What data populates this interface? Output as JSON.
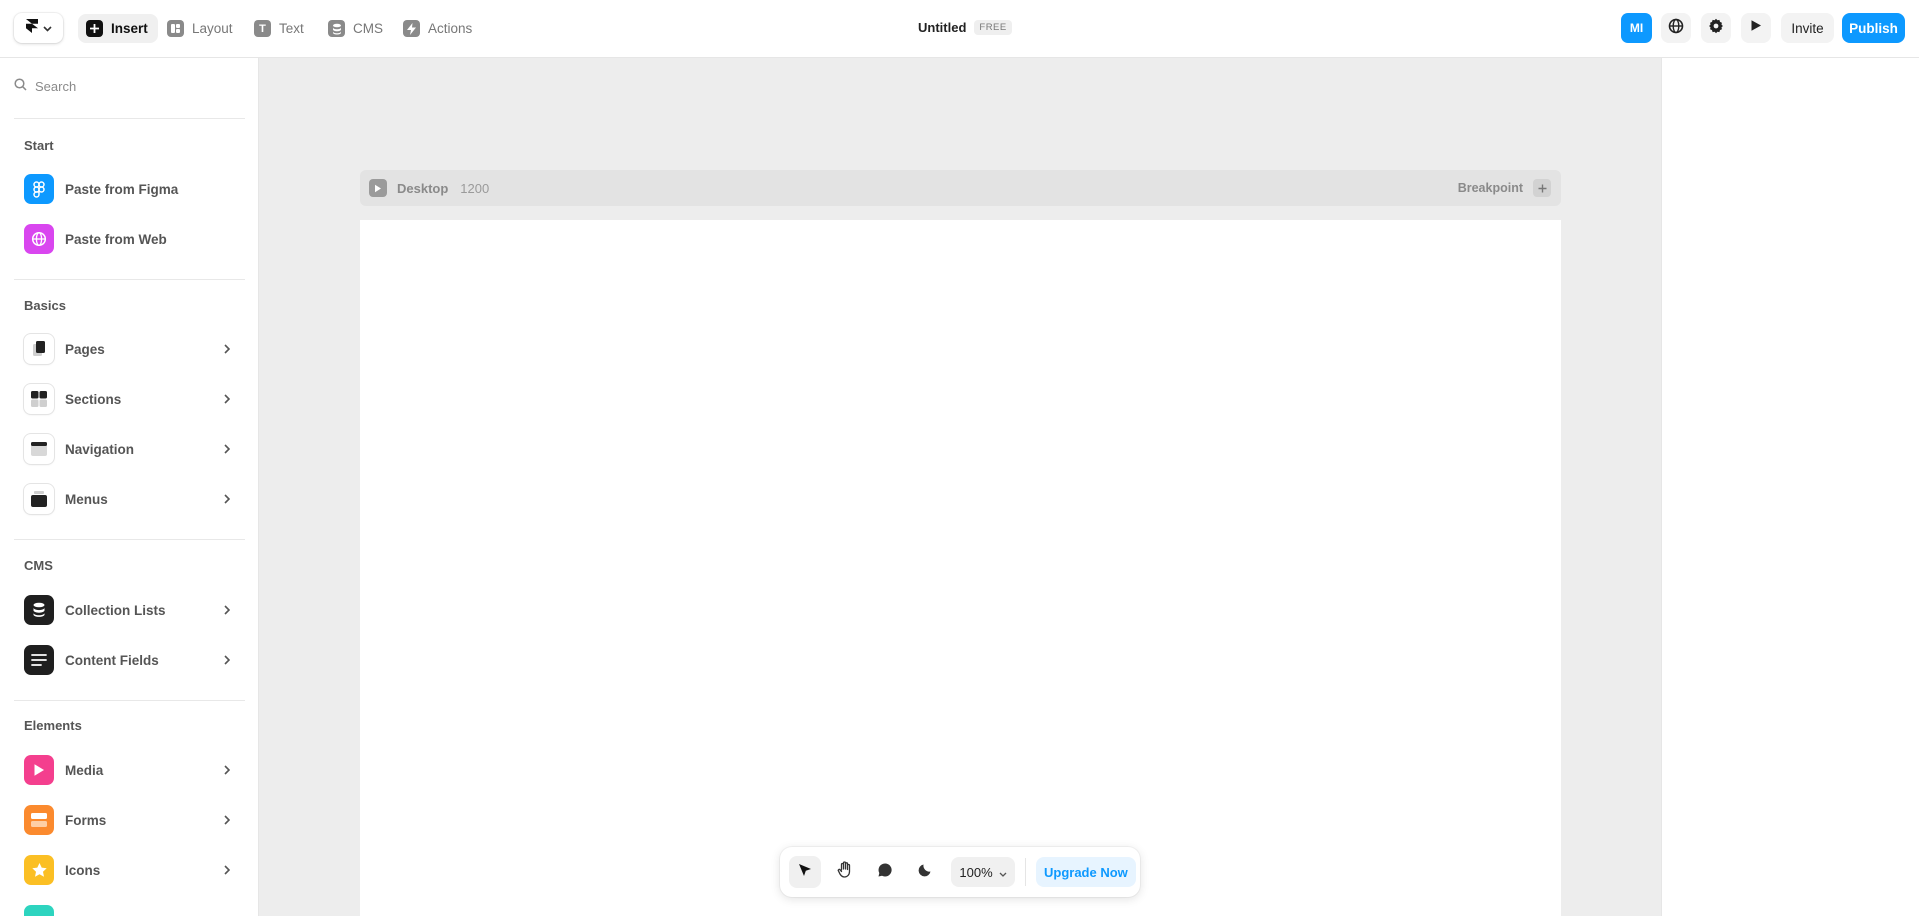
{
  "topbar": {
    "tabs": [
      {
        "label": "Insert",
        "icon": "plus-icon",
        "active": true
      },
      {
        "label": "Layout",
        "icon": "layout-icon",
        "active": false
      },
      {
        "label": "Text",
        "icon": "text-icon",
        "active": false
      },
      {
        "label": "CMS",
        "icon": "database-icon",
        "active": false
      },
      {
        "label": "Actions",
        "icon": "bolt-icon",
        "active": false
      }
    ],
    "doc_title": "Untitled",
    "plan_badge": "FREE",
    "avatar_initials": "MI",
    "invite_label": "Invite",
    "publish_label": "Publish"
  },
  "sidebar": {
    "search_placeholder": "Search",
    "sections": [
      {
        "title": "Start",
        "items": [
          {
            "label": "Paste from Figma",
            "icon": "figma-icon",
            "color": "#0d99ff"
          },
          {
            "label": "Paste from Web",
            "icon": "globe-icon",
            "color": "#d946ef"
          }
        ]
      },
      {
        "title": "Basics",
        "items": [
          {
            "label": "Pages",
            "icon": "pages-icon"
          },
          {
            "label": "Sections",
            "icon": "sections-icon"
          },
          {
            "label": "Navigation",
            "icon": "navigation-icon"
          },
          {
            "label": "Menus",
            "icon": "menus-icon"
          }
        ]
      },
      {
        "title": "CMS",
        "items": [
          {
            "label": "Collection Lists",
            "icon": "database-icon",
            "color": "#1f1f1f"
          },
          {
            "label": "Content Fields",
            "icon": "lines-icon",
            "color": "#1f1f1f"
          }
        ]
      },
      {
        "title": "Elements",
        "items": [
          {
            "label": "Media",
            "icon": "play-icon",
            "color": "#f43f8e"
          },
          {
            "label": "Forms",
            "icon": "forms-icon",
            "color": "#fb8a2e"
          },
          {
            "label": "Icons",
            "icon": "star-icon",
            "color": "#fbbf24"
          }
        ]
      }
    ]
  },
  "canvas": {
    "frame_name": "Desktop",
    "frame_width": "1200",
    "breakpoint_label": "Breakpoint"
  },
  "toolbar": {
    "zoom": "100%",
    "upgrade_label": "Upgrade Now"
  }
}
